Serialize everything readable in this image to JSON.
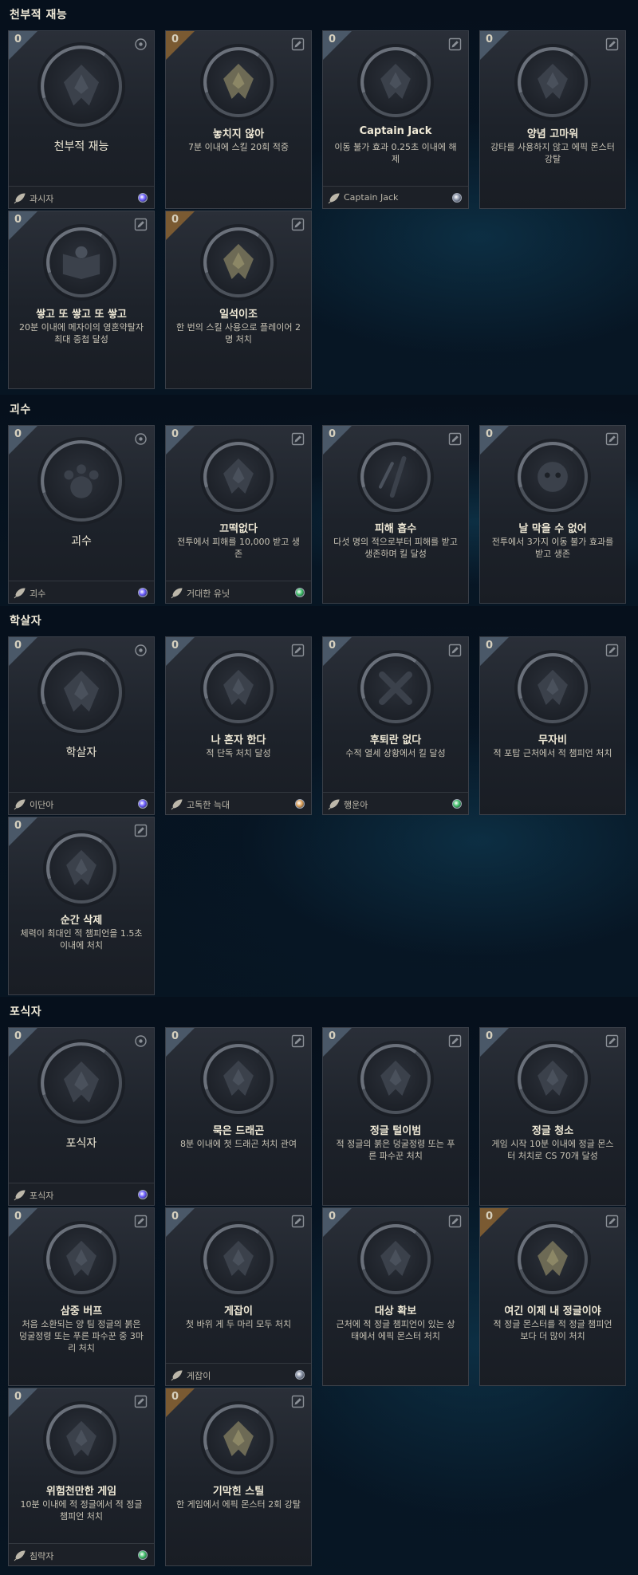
{
  "colors": {
    "gem_purple": "#6a5cff",
    "gem_gray": "#8a94a8",
    "gem_green": "#3fbf6a",
    "gem_orange": "#e0a25a",
    "corner_gray": "#4a5868",
    "corner_gold": "#7a5a32"
  },
  "sections": [
    {
      "title": "천부적 재능",
      "cards": [
        {
          "count": "0",
          "title": "천부적 재능",
          "desc": "",
          "footer": "과시자",
          "gem": "purple",
          "icon": "talent-emblem-icon",
          "top_icon": "target-icon",
          "corner": "gray",
          "big": true
        },
        {
          "count": "0",
          "title": "놓치지 않아",
          "desc": "7분 이내에 스킬 20회 적중",
          "footer": "",
          "gem": "",
          "icon": "hook-emblem-icon",
          "top_icon": "edit-icon",
          "corner": "gold",
          "big": false
        },
        {
          "count": "0",
          "title": "Captain Jack",
          "desc": "이동 불가 효과 0.25초 이내에 해제",
          "footer": "Captain Jack",
          "gem": "gray",
          "icon": "skull-flame-emblem-icon",
          "top_icon": "edit-icon",
          "corner": "gray",
          "big": false
        },
        {
          "count": "0",
          "title": "양념 고마워",
          "desc": "강타를 사용하지 않고 에픽 몬스터 강탈",
          "footer": "",
          "gem": "",
          "icon": "monster-emblem-icon",
          "top_icon": "edit-icon",
          "corner": "gray",
          "big": false
        },
        {
          "count": "0",
          "title": "쌓고 또 쌓고 또 쌓고",
          "desc": "20분 이내에 메자이의 영혼약탈자 최대 중첩 달성",
          "footer": "",
          "gem": "",
          "icon": "book-emblem-icon",
          "top_icon": "edit-icon",
          "corner": "gray",
          "big": false
        },
        {
          "count": "0",
          "title": "일석이조",
          "desc": "한 번의 스킬 사용으로 플레이어 2명 처치",
          "footer": "",
          "gem": "",
          "icon": "stone-emblem-icon",
          "top_icon": "edit-icon",
          "corner": "gold",
          "big": false
        }
      ]
    },
    {
      "title": "괴수",
      "cards": [
        {
          "count": "0",
          "title": "괴수",
          "desc": "",
          "footer": "괴수",
          "gem": "purple",
          "icon": "paw-emblem-icon",
          "top_icon": "target-icon",
          "corner": "gray",
          "big": true
        },
        {
          "count": "0",
          "title": "끄떡없다",
          "desc": "전투에서 피해를 10,000 받고 생존",
          "footer": "거대한 유닛",
          "gem": "green",
          "icon": "shield-emblem-icon",
          "top_icon": "edit-icon",
          "corner": "gray",
          "big": false
        },
        {
          "count": "0",
          "title": "피해 흡수",
          "desc": "다섯 명의 적으로부터 피해를 받고 생존하며 킬 달성",
          "footer": "",
          "gem": "",
          "icon": "swords-emblem-icon",
          "top_icon": "edit-icon",
          "corner": "gray",
          "big": false
        },
        {
          "count": "0",
          "title": "날 막을 수 없어",
          "desc": "전투에서 3가지 이동 불가 효과를 받고 생존",
          "footer": "",
          "gem": "",
          "icon": "face-emblem-icon",
          "top_icon": "edit-icon",
          "corner": "gray",
          "big": false
        }
      ]
    },
    {
      "title": "학살자",
      "cards": [
        {
          "count": "0",
          "title": "학살자",
          "desc": "",
          "footer": "이단아",
          "gem": "purple",
          "icon": "blades-emblem-icon",
          "top_icon": "target-icon",
          "corner": "gray",
          "big": true
        },
        {
          "count": "0",
          "title": "나 혼자 한다",
          "desc": "적 단독 처치 달성",
          "footer": "고독한 늑대",
          "gem": "orange",
          "icon": "sword-stone-emblem-icon",
          "top_icon": "edit-icon",
          "corner": "gray",
          "big": false
        },
        {
          "count": "0",
          "title": "후퇴란 없다",
          "desc": "수적 열세 상황에서 킬 달성",
          "footer": "행운아",
          "gem": "green",
          "icon": "cross-emblem-icon",
          "top_icon": "edit-icon",
          "corner": "gray",
          "big": false
        },
        {
          "count": "0",
          "title": "무자비",
          "desc": "적 포탑 근처에서 적 챔피언 처치",
          "footer": "",
          "gem": "",
          "icon": "hood-emblem-icon",
          "top_icon": "edit-icon",
          "corner": "gray",
          "big": false
        },
        {
          "count": "0",
          "title": "순간 삭제",
          "desc": "체력이 최대인 적 챔피언을 1.5초 이내에 처치",
          "footer": "",
          "gem": "",
          "icon": "burst-emblem-icon",
          "top_icon": "edit-icon",
          "corner": "gray",
          "big": false
        }
      ]
    },
    {
      "title": "포식자",
      "cards": [
        {
          "count": "0",
          "title": "포식자",
          "desc": "",
          "footer": "포식자",
          "gem": "purple",
          "icon": "predator-emblem-icon",
          "top_icon": "target-icon",
          "corner": "gray",
          "big": true
        },
        {
          "count": "0",
          "title": "묵은 드래곤",
          "desc": "8분 이내에 첫 드래곤 처치 관여",
          "footer": "",
          "gem": "",
          "icon": "dragon-emblem-icon",
          "top_icon": "edit-icon",
          "corner": "gray",
          "big": false
        },
        {
          "count": "0",
          "title": "정글 털이범",
          "desc": "적 정글의 붉은 덩굴정령 또는 푸른 파수꾼 처치",
          "footer": "",
          "gem": "",
          "icon": "claw-emblem-icon",
          "top_icon": "edit-icon",
          "corner": "gray",
          "big": false
        },
        {
          "count": "0",
          "title": "정글 청소",
          "desc": "게임 시작 10분 이내에 정글 몬스터 처치로 CS 70개 달성",
          "footer": "",
          "gem": "",
          "icon": "scythe-emblem-icon",
          "top_icon": "edit-icon",
          "corner": "gray",
          "big": false
        },
        {
          "count": "0",
          "title": "삼중 버프",
          "desc": "처음 소환되는 양 팀 정글의 붉은 덩굴정령 또는 푸른 파수꾼 중 3마리 처치",
          "footer": "",
          "gem": "",
          "icon": "buff-emblem-icon",
          "top_icon": "edit-icon",
          "corner": "gray",
          "big": false
        },
        {
          "count": "0",
          "title": "게잡이",
          "desc": "첫 바위 게 두 마리 모두 처치",
          "footer": "게잡이",
          "gem": "gray",
          "icon": "crab-emblem-icon",
          "top_icon": "edit-icon",
          "corner": "gray",
          "big": false
        },
        {
          "count": "0",
          "title": "대상 확보",
          "desc": "근처에 적 정글 챔피언이 있는 상태에서 에픽 몬스터 처치",
          "footer": "",
          "gem": "",
          "icon": "grip-emblem-icon",
          "top_icon": "edit-icon",
          "corner": "gray",
          "big": false
        },
        {
          "count": "0",
          "title": "여긴 이제 내 정글이야",
          "desc": "적 정글 몬스터를 적 정글 챔피언보다 더 많이 처치",
          "footer": "",
          "gem": "",
          "icon": "beast-emblem-icon",
          "top_icon": "edit-icon",
          "corner": "gold",
          "big": false
        },
        {
          "count": "0",
          "title": "위험천만한 게임",
          "desc": "10분 이내에 적 정글에서 적 정글 챔피언 처치",
          "footer": "침략자",
          "gem": "green",
          "icon": "spikes-emblem-icon",
          "top_icon": "edit-icon",
          "corner": "gray",
          "big": false
        },
        {
          "count": "0",
          "title": "기막힌 스틸",
          "desc": "한 게임에서 에픽 몬스터 2회 강탈",
          "footer": "",
          "gem": "",
          "icon": "thief-emblem-icon",
          "top_icon": "edit-icon",
          "corner": "gold",
          "big": false
        }
      ]
    }
  ]
}
